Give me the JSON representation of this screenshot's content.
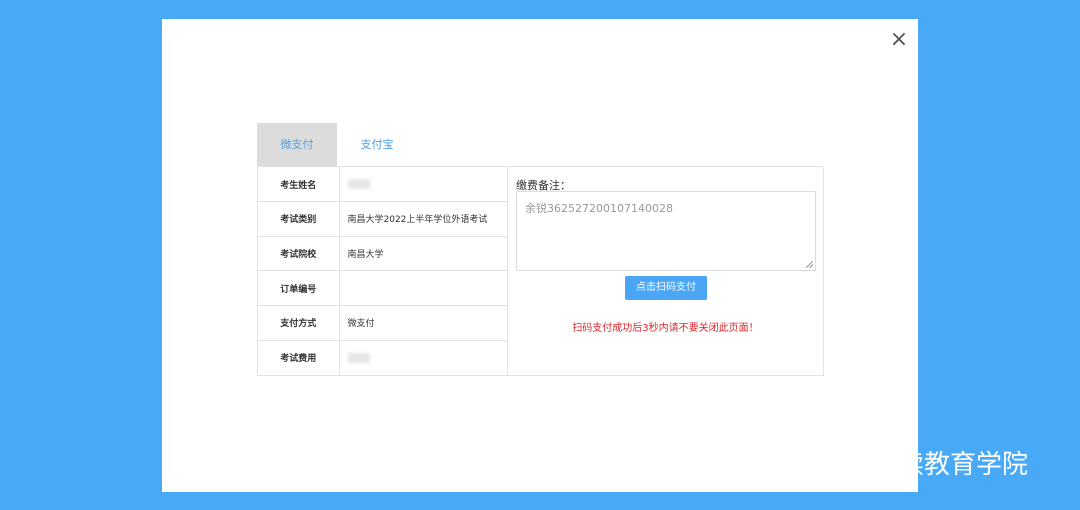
{
  "dialog": {
    "close_glyph": "×",
    "tabs": [
      {
        "label": "微支付",
        "active": true
      },
      {
        "label": "支付宝",
        "active": false
      }
    ],
    "info_rows": [
      {
        "label": "考生姓名",
        "value": "",
        "redacted": true
      },
      {
        "label": "考试类别",
        "value": "南昌大学2022上半年学位外语考试",
        "redacted": false
      },
      {
        "label": "考试院校",
        "value": "南昌大学",
        "redacted": false
      },
      {
        "label": "订单编号",
        "value": "",
        "redacted": false
      },
      {
        "label": "支付方式",
        "value": "微支付",
        "redacted": false
      },
      {
        "label": "考试费用",
        "value": "",
        "redacted": true
      }
    ],
    "note_label": "缴费备注：",
    "note_value": "余锐362527200107140028",
    "scan_button": "点击扫码支付",
    "warning": "扫码支付成功后3秒内请不要关闭此页面！"
  },
  "watermark": {
    "text": "南昌大学继续教育学院",
    "icon": "wechat-icon"
  },
  "colors": {
    "background": "#48a9f7",
    "button": "#4ba6f5",
    "warning": "#e0252b"
  }
}
